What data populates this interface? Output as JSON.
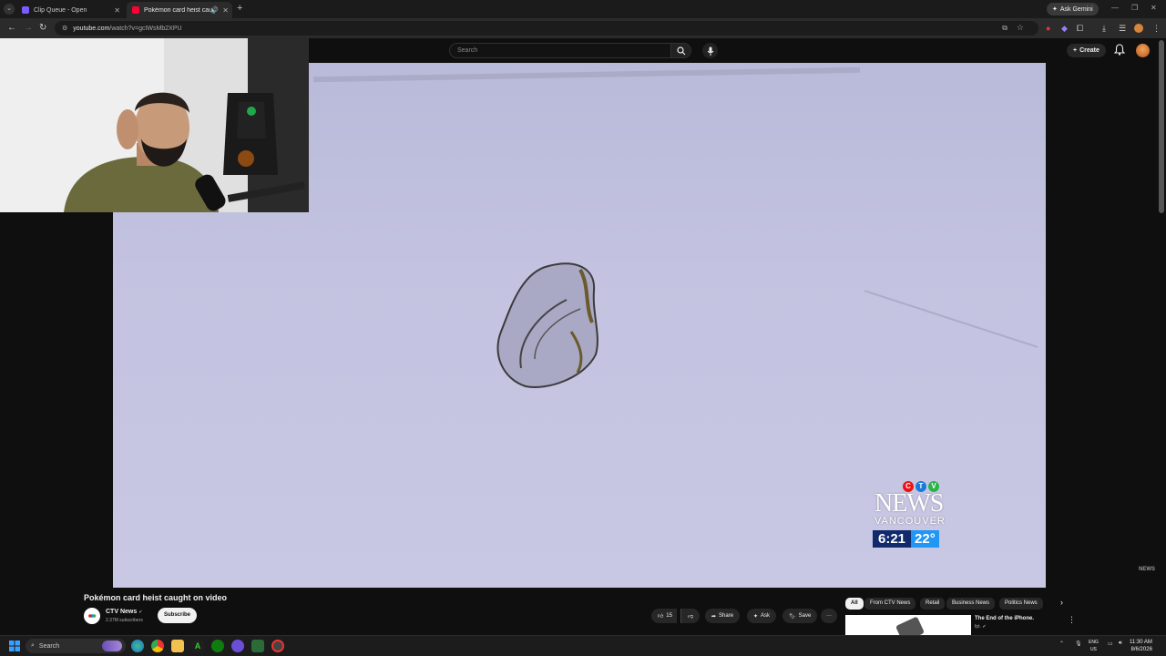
{
  "browser": {
    "tabs": [
      {
        "title": "Clip Queue - Open",
        "active": false,
        "favicon_color": "#7b5cff"
      },
      {
        "title": "Pokémon card heist caugh",
        "active": true,
        "favicon_color": "#ff0033"
      }
    ],
    "ask_gemini": "Ask Gemini",
    "url_host": "youtube.com",
    "url_path": "/watch?v=gcIWsMb2XPU"
  },
  "youtube": {
    "search_placeholder": "Search",
    "create_label": "Create",
    "video": {
      "title": "Pokémon card heist caught on video",
      "channel": "CTV News",
      "subscribers": "2.37M subscribers",
      "subscribe_label": "Subscribe",
      "likes": "15",
      "share_label": "Share",
      "ask_label": "Ask",
      "save_label": "Save"
    },
    "overlay": {
      "ctv_letters": [
        "C",
        "T",
        "V"
      ],
      "brand": "NEWS",
      "city": "VANCOUVER",
      "time": "6:21",
      "temperature": "22°",
      "watermark": "NEWS"
    },
    "chips": [
      "All",
      "From CTV News",
      "Retail",
      "Business News",
      "Politics News"
    ],
    "recommended": {
      "title": "The End of the iPhone.",
      "channel": "fpt."
    },
    "colors": {
      "brand_red": "#ff0033",
      "ctv_blue": "#102a6b",
      "ctv_light_blue": "#2196f3"
    }
  },
  "taskbar": {
    "search_label": "Search",
    "lang_top": "ENG",
    "lang_bottom": "US",
    "time": "11:30 AM",
    "date": "8/6/2026"
  }
}
